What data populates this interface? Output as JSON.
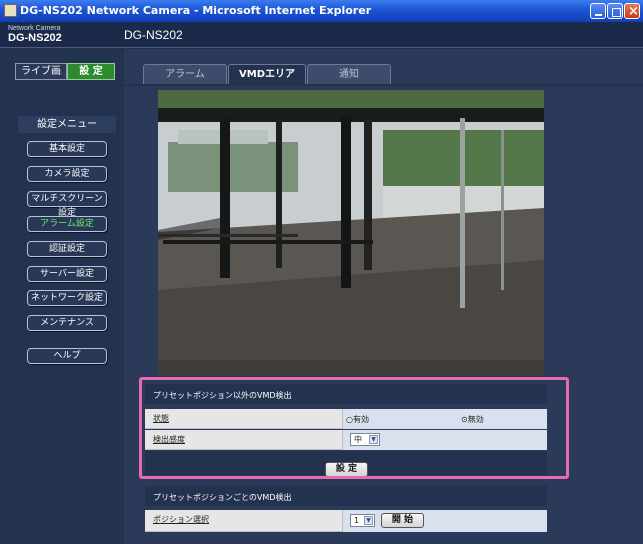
{
  "window": {
    "title": "DG-NS202 Network Camera - Microsoft Internet Explorer"
  },
  "header": {
    "brand_small": "Network Camera",
    "brand_big": "DG-NS202",
    "camera_name": "DG-NS202"
  },
  "mode": {
    "live_label": "ライブ画",
    "setup_label": "設 定"
  },
  "sidebar": {
    "menu_heading": "設定メニュー",
    "items": [
      {
        "label": "基本設定",
        "active": false
      },
      {
        "label": "カメラ設定",
        "active": false
      },
      {
        "label": "マルチスクリーン設定",
        "active": false
      },
      {
        "label": "アラーム設定",
        "active": true
      },
      {
        "label": "認証設定",
        "active": false
      },
      {
        "label": "サーバー設定",
        "active": false
      },
      {
        "label": "ネットワーク設定",
        "active": false
      },
      {
        "label": "メンテナンス",
        "active": false
      }
    ],
    "help_label": "ヘルプ"
  },
  "tabs": [
    {
      "label": "アラーム",
      "active": false
    },
    {
      "label": "VMDエリア",
      "active": true
    },
    {
      "label": "通知",
      "active": false
    }
  ],
  "vmd_other": {
    "section_title": "プリセットポジション以外のVMD検出",
    "status_label": "状態",
    "status_options": [
      "有効",
      "無効"
    ],
    "status_selected": "無効",
    "sensitivity_label": "検出感度",
    "sensitivity_value": "中",
    "set_button": "設 定"
  },
  "vmd_preset": {
    "section_title": "プリセットポジションごとのVMD検出",
    "position_label": "ポジション選択",
    "position_value": "1",
    "start_button": "開 始"
  },
  "colors": {
    "highlight": "#e86ab0",
    "active_menu": "#6cf06c",
    "setup_active": "#2e8a2e"
  }
}
